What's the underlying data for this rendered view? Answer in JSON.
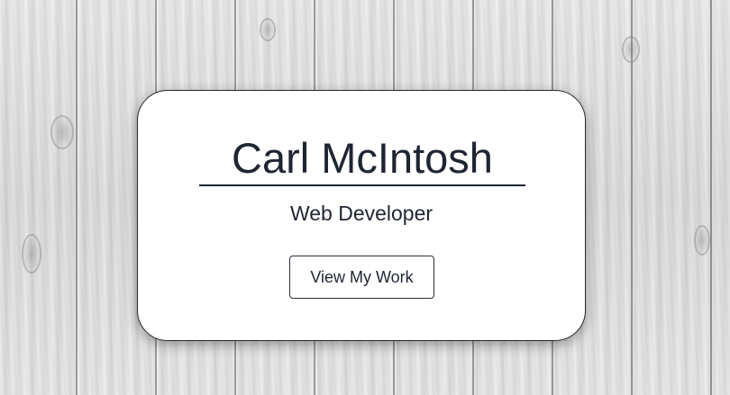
{
  "profile": {
    "name": "Carl McIntosh",
    "title": "Web Developer",
    "cta_label": "View My Work"
  },
  "colors": {
    "text": "#1f2533",
    "card_background": "#ffffff",
    "page_background": "#dcdcdc"
  }
}
